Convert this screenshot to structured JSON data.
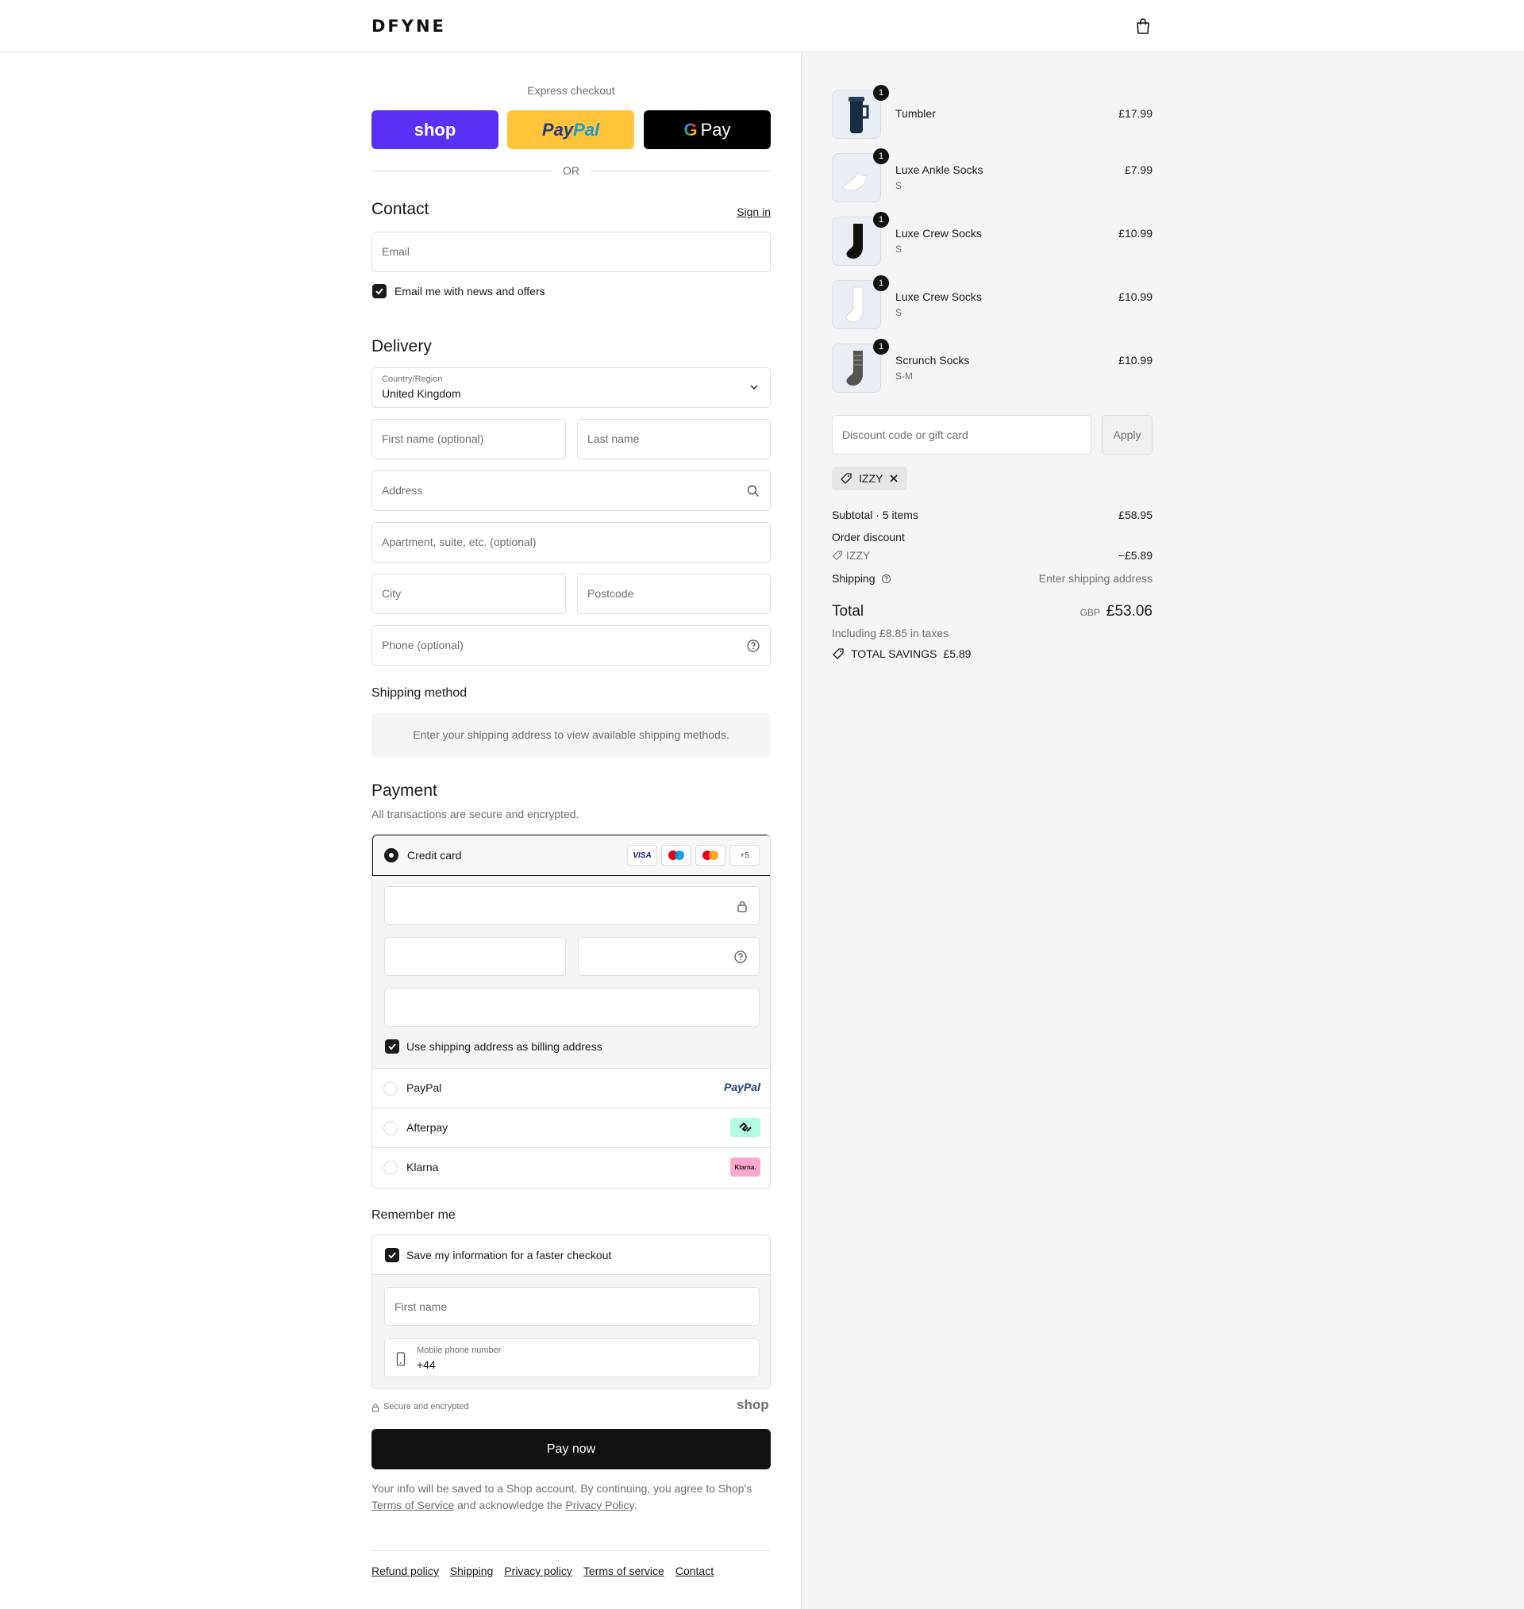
{
  "header": {
    "logo": "DFYNE"
  },
  "express": {
    "label": "Express checkout",
    "shop_label": "shop",
    "paypal_dark": "Pay",
    "paypal_light": "Pal",
    "gpay_label": "Pay",
    "or_label": "OR"
  },
  "contact": {
    "title": "Contact",
    "sign_in": "Sign in",
    "email_placeholder": "Email",
    "news_label": "Email me with news and offers"
  },
  "delivery": {
    "title": "Delivery",
    "country_label": "Country/Region",
    "country_value": "United Kingdom",
    "first_name": "First name (optional)",
    "last_name": "Last name",
    "address": "Address",
    "apartment": "Apartment, suite, etc. (optional)",
    "city": "City",
    "postcode": "Postcode",
    "phone": "Phone (optional)"
  },
  "shipping_method": {
    "title": "Shipping method",
    "info": "Enter your shipping address to view available shipping methods."
  },
  "payment": {
    "title": "Payment",
    "subtitle": "All transactions are secure and encrypted.",
    "credit_card": "Credit card",
    "card_logos": [
      "VISA",
      "Maestro",
      "Mastercard",
      "+5"
    ],
    "billing_label": "Use shipping address as billing address",
    "options": [
      {
        "label": "PayPal",
        "logo": "PayPal"
      },
      {
        "label": "Afterpay",
        "logo": "afterpay-icon"
      },
      {
        "label": "Klarna",
        "logo": "Klarna."
      }
    ]
  },
  "remember": {
    "title": "Remember me",
    "save_label": "Save my information for a faster checkout",
    "first_name": "First name",
    "mobile_label": "Mobile phone number",
    "mobile_value": "+44",
    "secure": "Secure and encrypted",
    "shop_brand": "shop"
  },
  "pay_now": "Pay now",
  "legal": {
    "text1": "Your info will be saved to a Shop account. By continuing, you agree to Shop's",
    "terms": "Terms of Service",
    "text2": "and acknowledge the",
    "privacy": "Privacy Policy",
    "text3": "."
  },
  "footer": [
    "Refund policy",
    "Shipping",
    "Privacy policy",
    "Terms of service",
    "Contact"
  ],
  "summary": {
    "items": [
      {
        "qty": "1",
        "name": "Tumbler",
        "variant": "",
        "price": "£17.99"
      },
      {
        "qty": "1",
        "name": "Luxe Ankle Socks",
        "variant": "S",
        "price": "£7.99"
      },
      {
        "qty": "1",
        "name": "Luxe Crew Socks",
        "variant": "S",
        "price": "£10.99"
      },
      {
        "qty": "1",
        "name": "Luxe Crew Socks",
        "variant": "S",
        "price": "£10.99"
      },
      {
        "qty": "1",
        "name": "Scrunch Socks",
        "variant": "S-M",
        "price": "£10.99"
      }
    ],
    "discount_placeholder": "Discount code or gift card",
    "apply": "Apply",
    "applied_code": "IZZY",
    "subtotal_label": "Subtotal · 5 items",
    "subtotal_value": "£58.95",
    "order_discount_label": "Order discount",
    "discount_code": "IZZY",
    "discount_value": "−£5.89",
    "shipping_label": "Shipping",
    "shipping_value": "Enter shipping address",
    "total_label": "Total",
    "currency": "GBP",
    "total_value": "£53.06",
    "taxes": "Including £8.85 in taxes",
    "savings_label": "TOTAL SAVINGS",
    "savings_value": "£5.89"
  }
}
